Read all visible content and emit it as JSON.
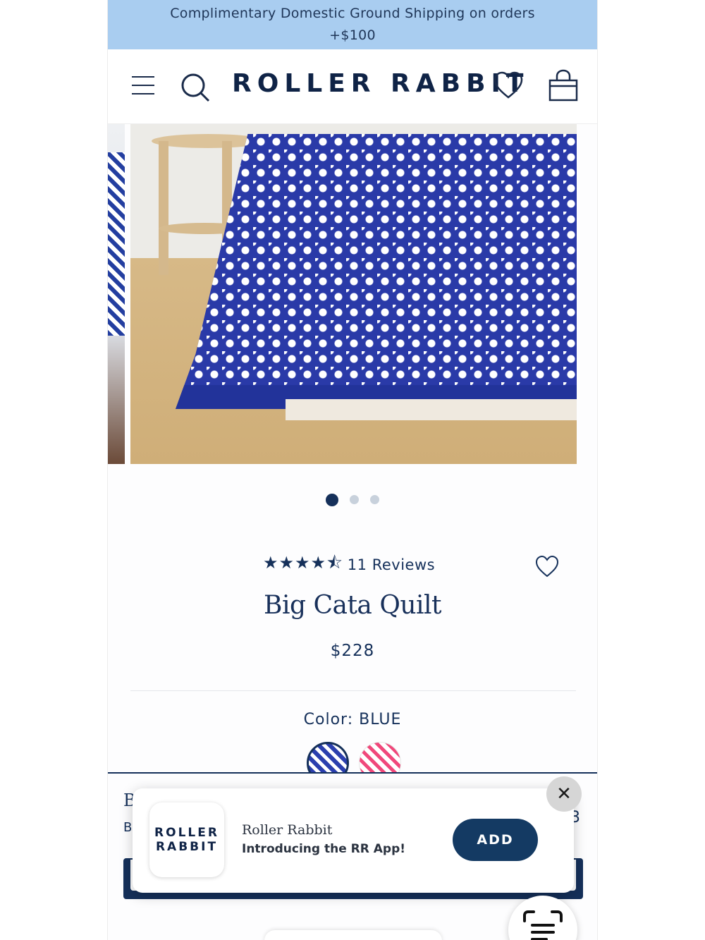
{
  "promo": {
    "line1": "Complimentary Domestic Ground Shipping on orders",
    "line2": "+$100"
  },
  "header": {
    "logo": "ROLLER RABBIT",
    "icons": [
      "menu-icon",
      "search-icon",
      "heart-icon",
      "shopping-bag-icon"
    ]
  },
  "gallery": {
    "slide_count": 3,
    "active_index": 0
  },
  "product": {
    "rating_stars": "★★★★⯪",
    "rating_value": 4.5,
    "reviews_label": "11 Reviews",
    "title": "Big Cata Quilt",
    "price": "$228",
    "color_label": "Color: BLUE",
    "swatches": [
      {
        "name": "BLUE",
        "color": "#2b3fae",
        "selected": true
      },
      {
        "name": "PINK",
        "color": "#f0487b",
        "selected": false
      }
    ]
  },
  "peek": {
    "b1": "B",
    "b2": "B",
    "right": "3"
  },
  "app_banner": {
    "icon_line1": "ROLLER",
    "icon_line2": "RABBIT",
    "name": "Roller Rabbit",
    "description": "Introducing the RR App!",
    "add_label": "ADD",
    "close_label": "✕"
  },
  "colors": {
    "promo_bg": "#a9cdf0",
    "brand_navy": "#15305a",
    "add_button": "#143a63"
  }
}
